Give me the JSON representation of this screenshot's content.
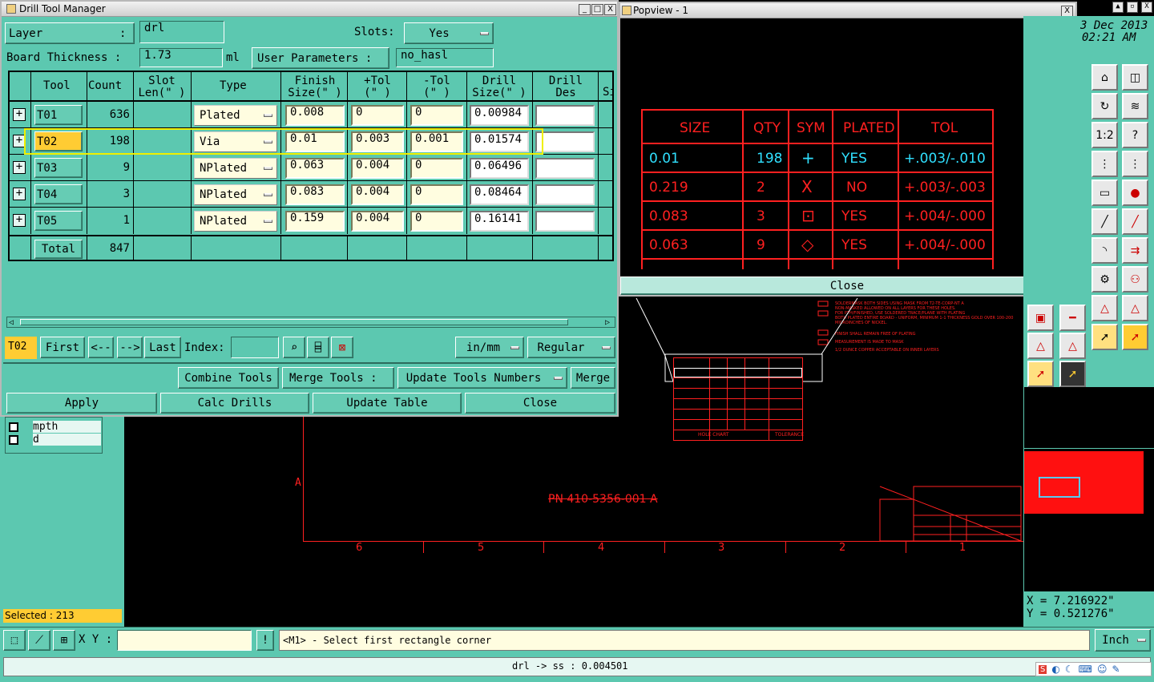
{
  "drill_window": {
    "title": "Drill Tool Manager",
    "layer_label": "Layer",
    ":": ":",
    "layer_value": "drl",
    "slots_label": "Slots:",
    "slots_value": "Yes",
    "thickness_label": "Board Thickness :",
    "thickness_value": "1.73",
    "thickness_unit": "ml",
    "user_params_label": "User Parameters :",
    "user_params_value": "no_hasl"
  },
  "table": {
    "headers": {
      "tool": "Tool",
      "count": "Count",
      "slot": "Slot\nLen(\" )",
      "type": "Type",
      "finish": "Finish\nSize(\" )",
      "ptol": "+Tol\n(\" )",
      "mtol": "-Tol\n(\" )",
      "drill": "Drill\nSize(\" )",
      "des": "Drill\nDes",
      "si": "Si"
    },
    "rows": [
      {
        "tool": "T01",
        "count": "636",
        "type": "Plated",
        "finish": "0.008",
        "ptol": "0",
        "mtol": "0",
        "drill": "0.00984"
      },
      {
        "tool": "T02",
        "count": "198",
        "type": "Via",
        "finish": "0.01",
        "ptol": "0.003",
        "mtol": "0.001",
        "drill": "0.01574"
      },
      {
        "tool": "T03",
        "count": "9",
        "type": "NPlated",
        "finish": "0.063",
        "ptol": "0.004",
        "mtol": "0",
        "drill": "0.06496"
      },
      {
        "tool": "T04",
        "count": "3",
        "type": "NPlated",
        "finish": "0.083",
        "ptol": "0.004",
        "mtol": "0",
        "drill": "0.08464"
      },
      {
        "tool": "T05",
        "count": "1",
        "type": "NPlated",
        "finish": "0.159",
        "ptol": "0.004",
        "mtol": "0",
        "drill": "0.16141"
      }
    ],
    "total_label": "Total",
    "total_count": "847"
  },
  "nav": {
    "current": "T02",
    "first": "First",
    "prev": "<--",
    "next": "-->",
    "last": "Last",
    "index_label": "Index:",
    "units": "in/mm",
    "mode": "Regular"
  },
  "actions": {
    "combine": "Combine Tools",
    "merge_tools": "Merge Tools :",
    "update_nums": "Update Tools Numbers",
    "merge": "Merge",
    "apply": "Apply",
    "calc": "Calc Drills",
    "update_table": "Update Table",
    "close": "Close"
  },
  "popview": {
    "title": "Popview - 1",
    "close": "Close",
    "headers": [
      "SIZE",
      "QTY",
      "SYM",
      "PLATED",
      "TOL"
    ],
    "rows": [
      {
        "size": "0.01",
        "qty": "198",
        "sym": "+",
        "plated": "YES",
        "tol": "+.003/-.010"
      },
      {
        "size": "0.219",
        "qty": "2",
        "sym": "X",
        "plated": "NO",
        "tol": "+.003/-.003"
      },
      {
        "size": "0.083",
        "qty": "3",
        "sym": "⊡",
        "plated": "YES",
        "tol": "+.004/-.000"
      },
      {
        "size": "0.063",
        "qty": "9",
        "sym": "◇",
        "plated": "YES",
        "tol": "+.004/-.000"
      }
    ]
  },
  "datetime": {
    "date": "3 Dec 2013",
    "time": "02:21 AM"
  },
  "layers": [
    "mpth",
    "d"
  ],
  "selected": "Selected : 213",
  "coords": {
    "x": "X = 7.216922\"",
    "y": "Y = 0.521276\""
  },
  "bottom": {
    "xy_label": "X Y :",
    "prompt": "<M1> - Select first rectangle corner",
    "unit": "Inch",
    "status": "drl -> ss : 0.004501"
  },
  "canvas": {
    "pn": "PN 410-5356-001 A",
    "ruler": [
      "6",
      "5",
      "4",
      "3",
      "2",
      "1"
    ],
    "side_letter": "A",
    "hole_chart": "HOLE CHART",
    "tolerance": "TOLERANCE"
  }
}
